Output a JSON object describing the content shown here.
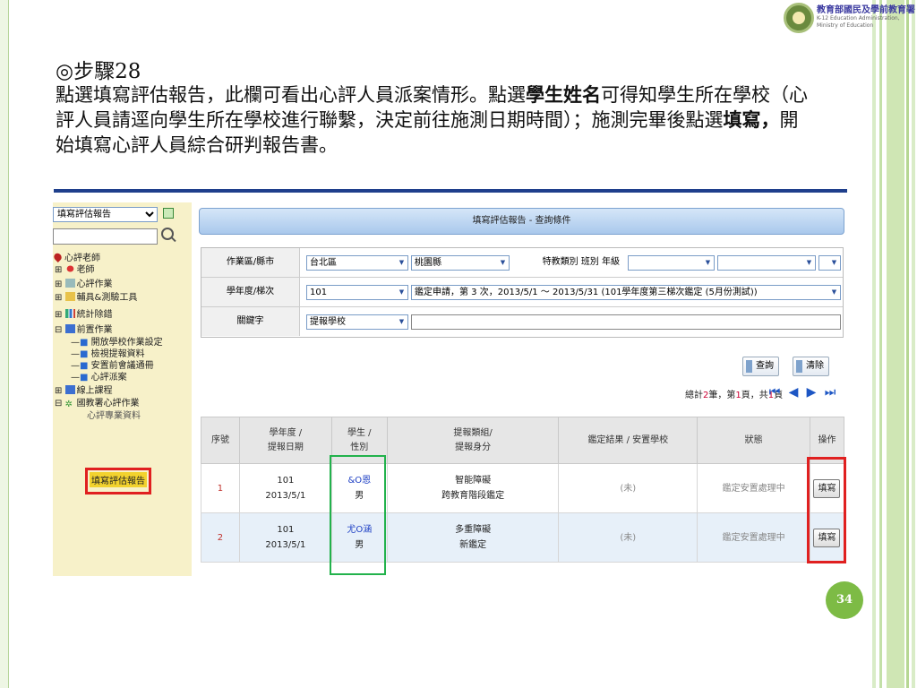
{
  "logo": {
    "title": "教育部國民及學前教育署",
    "subtitle_1": "K-12 Education Administration,",
    "subtitle_2": "Ministry of Education"
  },
  "slide": {
    "step_title": "◎步驟28",
    "text_1": "點選填寫評估報告，此欄可看出心評人員派案情形。點選",
    "bold_1": "學生姓名",
    "text_2": "可得知學生所在學校（心評人員請逕向學生所在學校進行聯繫，決定前往施測日期時間）；施測完畢後點選",
    "bold_2": "填寫，",
    "text_3": "開始填寫心評人員綜合研判報告書。",
    "page_number": "34"
  },
  "tree": {
    "dropdown_value": "填寫評估報告",
    "nodes": {
      "n1": "心評老師",
      "n2": "老師",
      "n3": "心評作業",
      "n4": "輔具&測驗工具",
      "n5": "統計除錯",
      "n6": "前置作業",
      "n7": "開放學校作業設定",
      "n8": "檢視提報資料",
      "n9": "安置前會議通冊",
      "n10": "心評派案",
      "n11": "線上課程",
      "n12": "國教署心評作業",
      "n13": "心評專業資料",
      "n14": "填寫評估報告"
    }
  },
  "main": {
    "header_title": "填寫評估報告 - 查詢條件",
    "form": {
      "row1_label": "作業區/縣市",
      "area": "台北區",
      "county": "桃園縣",
      "row1_label2": "特教類別 班別 年級",
      "row2_label": "學年度/梯次",
      "year": "101",
      "batch": "鑑定申請，第 3 次，2013/5/1 ～ 2013/5/31 (101學年度第三梯次鑑定 (5月份測試))",
      "row3_label": "關鍵字",
      "keyword_type": "提報學校"
    },
    "buttons": {
      "query": "查詢",
      "clear": "清除"
    },
    "pager": {
      "prefix": "總計",
      "total": "2",
      "mid1": "筆，第",
      "page": "1",
      "mid2": "頁，共",
      "pages": "1",
      "suffix": "頁"
    },
    "table": {
      "headers": {
        "no": "序號",
        "year_a": "學年度 /",
        "year_b": "提報日期",
        "student_a": "學生 /",
        "student_b": "性別",
        "category_a": "提報類組/",
        "category_b": "提報身分",
        "result": "鑑定結果 / 安置學校",
        "status": "狀態",
        "action": "操作"
      },
      "rows": [
        {
          "no": "1",
          "year": "101",
          "date": "2013/5/1",
          "student": "&O恩",
          "gender": "男",
          "category": "智能障礙",
          "identity": "跨教育階段鑑定",
          "result": "(未)",
          "status": "鑑定安置處理中",
          "action": "填寫"
        },
        {
          "no": "2",
          "year": "101",
          "date": "2013/5/1",
          "student": "尤O涵",
          "gender": "男",
          "category": "多重障礙",
          "identity": "新鑑定",
          "result": "(未)",
          "status": "鑑定安置處理中",
          "action": "填寫"
        }
      ]
    }
  }
}
